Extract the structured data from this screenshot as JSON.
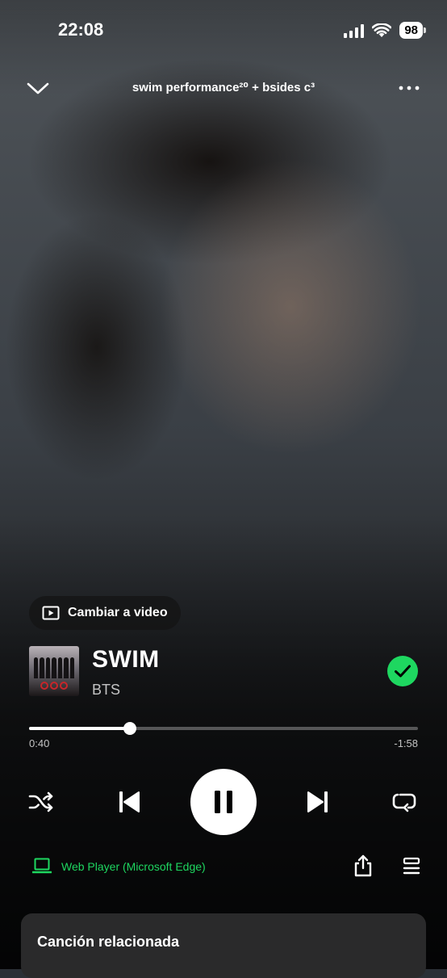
{
  "status_bar": {
    "time": "22:08",
    "battery": "98",
    "icons": [
      "signal-icon",
      "wifi-icon",
      "battery-icon"
    ]
  },
  "header": {
    "title": "swim performance²⁰ + bsides c³",
    "icons": [
      "chevron-down-icon",
      "more-icon"
    ]
  },
  "video_toggle": {
    "label": "Cambiar a video",
    "icon": "video-icon"
  },
  "track": {
    "title": "SWIM",
    "artist": "BTS",
    "liked": true
  },
  "progress": {
    "elapsed": "0:40",
    "remaining": "-1:58",
    "fraction": 0.26
  },
  "controls": {
    "icons": [
      "shuffle-icon",
      "previous-icon",
      "pause-icon",
      "next-icon",
      "repeat-icon"
    ]
  },
  "device": {
    "label": "Web Player (Microsoft Edge)",
    "icon": "laptop-icon"
  },
  "actions": {
    "icons": [
      "share-icon",
      "queue-icon"
    ]
  },
  "related": {
    "title": "Canción relacionada"
  },
  "colors": {
    "accent": "#1ed760",
    "card": "#2a2a2b",
    "pill": "#141414"
  }
}
